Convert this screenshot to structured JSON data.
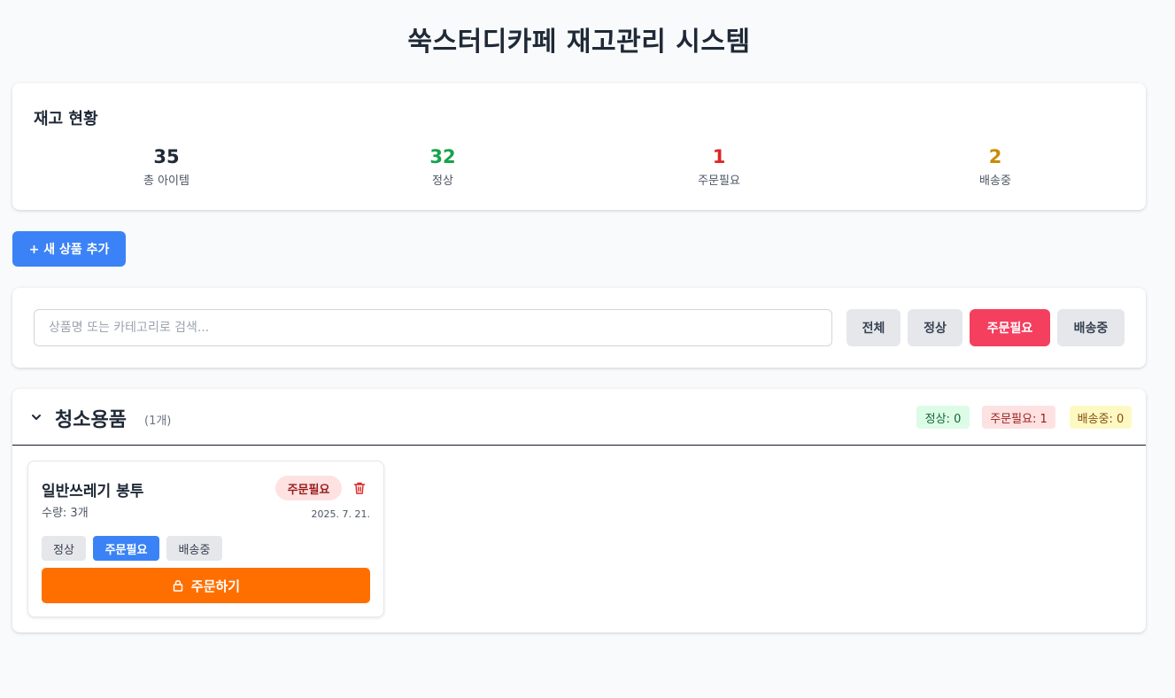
{
  "app": {
    "title": "쑥스터디카페 재고관리 시스템"
  },
  "summary": {
    "title": "재고 현황",
    "stats": [
      {
        "value": "35",
        "label": "총 아이템"
      },
      {
        "value": "32",
        "label": "정상"
      },
      {
        "value": "1",
        "label": "주문필요"
      },
      {
        "value": "2",
        "label": "배송중"
      }
    ]
  },
  "actions": {
    "add_label": "+ 새 상품 추가"
  },
  "filter": {
    "search_placeholder": "상품명 또는 카테고리로 검색...",
    "buttons": [
      "전체",
      "정상",
      "주문필요",
      "배송중"
    ],
    "active": "주문필요"
  },
  "category": {
    "name": "청소용품",
    "count": "(1개)",
    "badges": [
      "정상: 0",
      "주문필요: 1",
      "배송중: 0"
    ],
    "items": [
      {
        "name": "일반쓰레기 봉투",
        "quantity": "수량: 3개",
        "status": "주문필요",
        "date": "2025. 7. 21.",
        "status_options": [
          "정상",
          "주문필요",
          "배송중"
        ],
        "selected_status": "주문필요",
        "order_label": "주문하기"
      }
    ]
  },
  "colors": {
    "primary": "#3b82f6",
    "danger": "#f43f5e",
    "order": "#ff6f00",
    "ok": "#16a34a",
    "alert": "#dc2626",
    "shipping": "#ca8a04"
  },
  "icons": [
    "chevron-down-icon",
    "trash-icon",
    "lock-icon"
  ]
}
